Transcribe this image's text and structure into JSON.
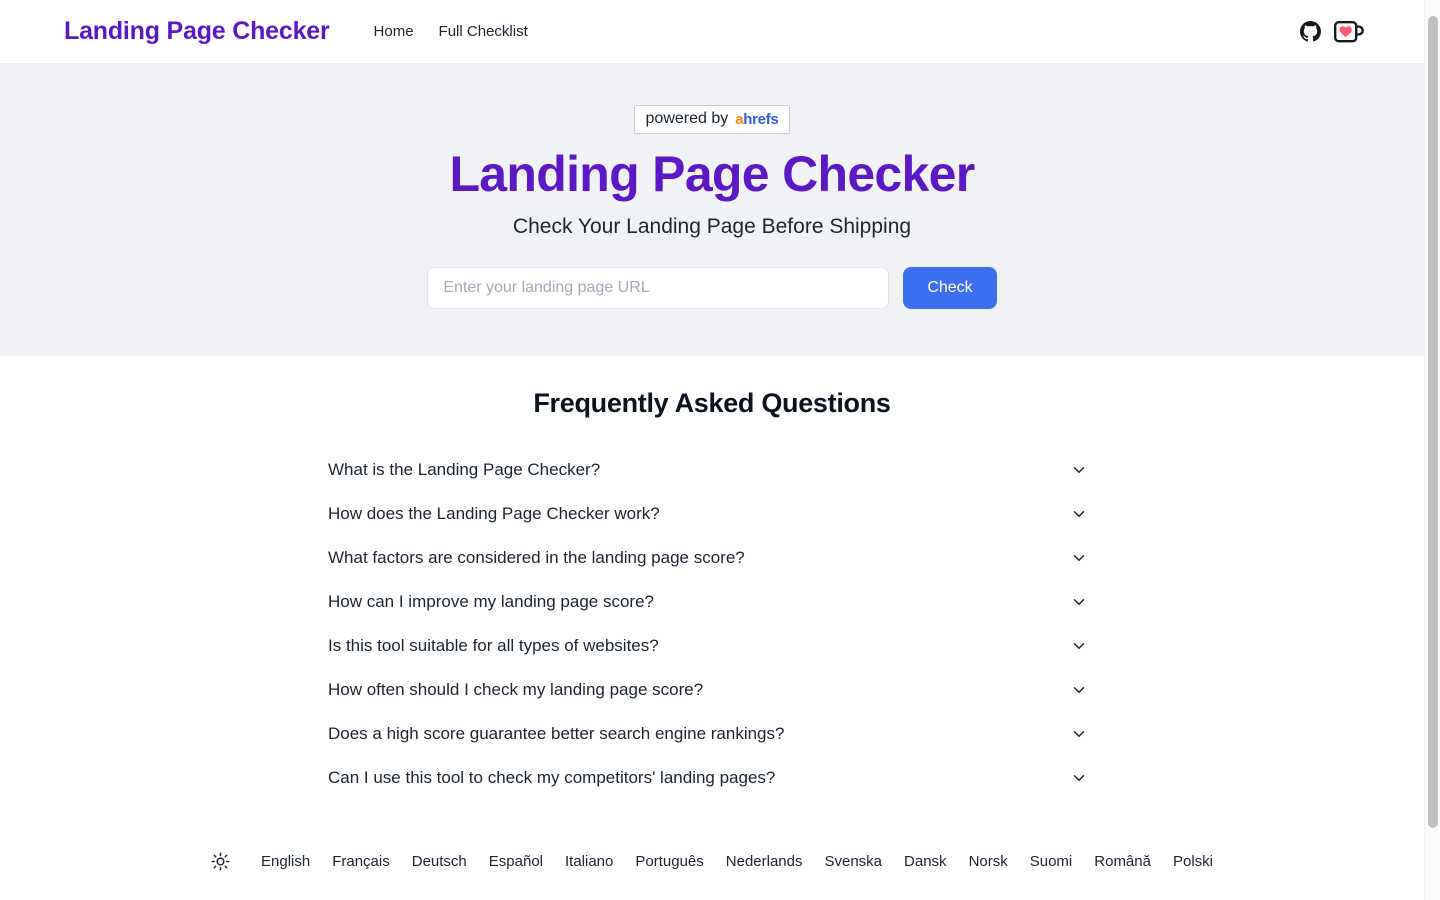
{
  "navbar": {
    "brand": "Landing Page Checker",
    "links": [
      {
        "label": "Home"
      },
      {
        "label": "Full Checklist"
      }
    ],
    "github_icon": "github-icon",
    "coffee_icon": "buy-me-a-coffee-icon"
  },
  "hero": {
    "badge_prefix": "powered by",
    "badge_brand_a": "a",
    "badge_brand_rest": "hrefs",
    "title": "Landing Page Checker",
    "subtitle": "Check Your Landing Page Before Shipping",
    "input_value": "",
    "input_placeholder": "Enter your landing page URL",
    "check_label": "Check"
  },
  "faq": {
    "title": "Frequently Asked Questions",
    "items": [
      {
        "question": "What is the Landing Page Checker?"
      },
      {
        "question": "How does the Landing Page Checker work?"
      },
      {
        "question": "What factors are considered in the landing page score?"
      },
      {
        "question": "How can I improve my landing page score?"
      },
      {
        "question": "Is this tool suitable for all types of websites?"
      },
      {
        "question": "How often should I check my landing page score?"
      },
      {
        "question": "Does a high score guarantee better search engine rankings?"
      },
      {
        "question": "Can I use this tool to check my competitors' landing pages?"
      }
    ],
    "chevron_icon": "chevron-down-icon"
  },
  "footer": {
    "theme_icon": "sun-icon",
    "languages": [
      {
        "label": "English"
      },
      {
        "label": "Français"
      },
      {
        "label": "Deutsch"
      },
      {
        "label": "Español"
      },
      {
        "label": "Italiano"
      },
      {
        "label": "Português"
      },
      {
        "label": "Nederlands"
      },
      {
        "label": "Svenska"
      },
      {
        "label": "Dansk"
      },
      {
        "label": "Norsk"
      },
      {
        "label": "Suomi"
      },
      {
        "label": "Română"
      },
      {
        "label": "Polski"
      }
    ]
  },
  "colors": {
    "brand_purple": "#5b18c4",
    "accent_blue": "#3b6ef0",
    "hero_bg": "#f1f2f5",
    "ahrefs_orange": "#ff8800",
    "ahrefs_blue": "#2f5fe0",
    "heart_pink": "#ff5a79"
  }
}
